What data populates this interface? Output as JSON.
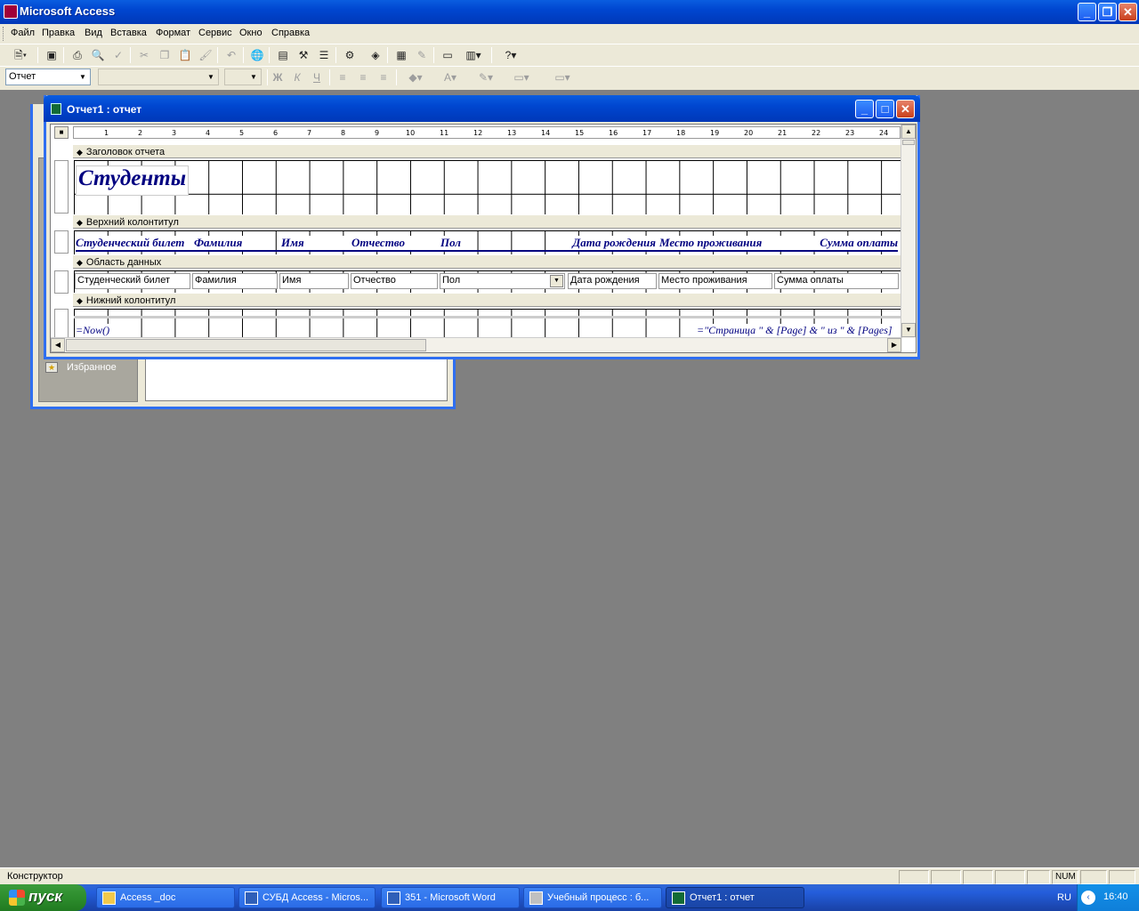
{
  "app": {
    "title": "Microsoft Access"
  },
  "menu": [
    {
      "label": "Файл"
    },
    {
      "label": "Правка"
    },
    {
      "label": "Вид"
    },
    {
      "label": "Вставка"
    },
    {
      "label": "Формат"
    },
    {
      "label": "Сервис"
    },
    {
      "label": "Окно"
    },
    {
      "label": "Справка"
    }
  ],
  "format_toolbar": {
    "object_combo": "Отчет",
    "font_combo": "",
    "size_combo": ""
  },
  "db_window": {
    "favorites_label": "Избранное"
  },
  "report_window": {
    "title": "Отчет1 : отчет",
    "ruler_ticks": [
      "1",
      "2",
      "3",
      "4",
      "5",
      "6",
      "7",
      "8",
      "9",
      "10",
      "11",
      "12",
      "13",
      "14",
      "15",
      "16",
      "17",
      "18",
      "19",
      "20",
      "21",
      "22",
      "23",
      "24"
    ],
    "sections": {
      "report_header": "Заголовок отчета",
      "page_header": "Верхний колонтитул",
      "detail": "Область данных",
      "page_footer": "Нижний колонтитул"
    },
    "report_title": "Студенты",
    "header_labels": [
      "Студенческий билет",
      "Фамилия",
      "Имя",
      "Отчество",
      "Пол",
      "Дата рождения",
      "Место проживания",
      "Сумма оплаты"
    ],
    "detail_fields": [
      "Студенческий билет",
      "Фамилия",
      "Имя",
      "Отчество",
      "Пол",
      "Дата рождения",
      "Место проживания",
      "Сумма оплаты"
    ],
    "footer_left": "=Now()",
    "footer_right": "=\"Страница \" & [Page] & \" из \" & [Pages]"
  },
  "status": {
    "text": "Конструктор",
    "num": "NUM"
  },
  "taskbar": {
    "start_label": "пуск",
    "tasks": [
      {
        "label": "Access _doc"
      },
      {
        "label": "СУБД Access - Micros..."
      },
      {
        "label": "351 - Microsoft Word"
      },
      {
        "label": "Учебный процесс : б..."
      },
      {
        "label": "Отчет1 : отчет"
      }
    ],
    "lang": "RU",
    "clock": "16:40"
  }
}
